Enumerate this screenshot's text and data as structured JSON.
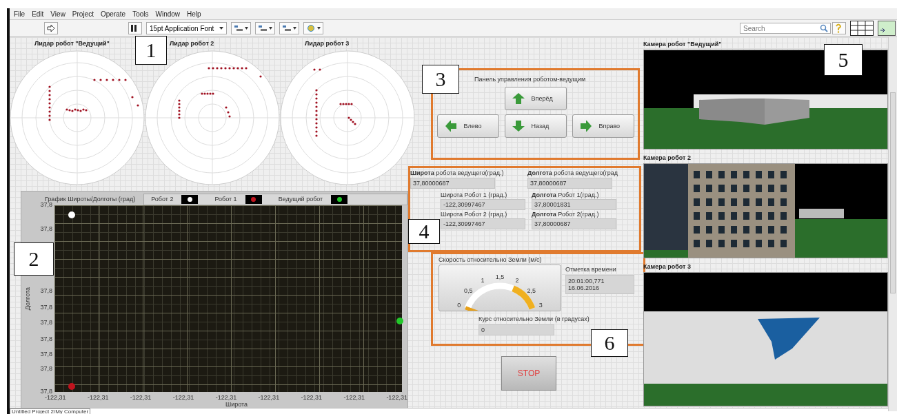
{
  "menu": [
    "File",
    "Edit",
    "View",
    "Project",
    "Operate",
    "Tools",
    "Window",
    "Help"
  ],
  "toolbar": {
    "font": "15pt Application Font",
    "search_placeholder": "Search"
  },
  "lidars": [
    {
      "title": "Лидар робот \"Ведущий\""
    },
    {
      "title": "Лидар робот 2"
    },
    {
      "title": "Лидар робот 3"
    }
  ],
  "chart": {
    "title": "График Широты/Долготы (град)",
    "y_label": "Долгота",
    "x_label": "Широта",
    "legend": [
      {
        "name": "Робот 2",
        "color": "#ffffff"
      },
      {
        "name": "Робот 1",
        "color": "#c0141e"
      },
      {
        "name": "Ведущий робот",
        "color": "#22c72a"
      }
    ],
    "y_tick_labels": [
      "37,8",
      "37,8",
      "37,8",
      "37,8",
      "37,8",
      "37,8",
      "37,8",
      "37,8",
      "37,8"
    ],
    "x_tick_labels": [
      "-122,31",
      "-122,31",
      "-122,31",
      "-122,31",
      "-122,31",
      "-122,31",
      "-122,31",
      "-122,31",
      "-122,31"
    ]
  },
  "control_panel": {
    "title": "Панель управления роботом-ведущим",
    "buttons": [
      {
        "label": "Вперёд",
        "kind": "up"
      },
      {
        "label": "Влево",
        "kind": "left"
      },
      {
        "label": "Назад",
        "kind": "down"
      },
      {
        "label": "Вправо",
        "kind": "right"
      }
    ]
  },
  "coordinates": {
    "leader": [
      {
        "label": "**Широта** робота ведущего(град.)",
        "value": "37,80000687"
      },
      {
        "label": "**Долгота** робота ведущего(град",
        "value": "37,80000687"
      }
    ],
    "robots": [
      {
        "label": "Широта Робот 1 (град.)",
        "value": "-122,30997467"
      },
      {
        "label": "**Долгота** Робот 1(град.)",
        "value": "37,80001831"
      },
      {
        "label": "Широта Робот 2 (град.)",
        "value": "-122,30997467"
      },
      {
        "label": "**Долгота** Робот 2(град.)",
        "value": "37,80000687"
      }
    ]
  },
  "speed": {
    "title": "Скорость относительно Земли (м/с)",
    "scale": [
      "0",
      "0,5",
      "1",
      "1,5",
      "2",
      "2,5",
      "3"
    ],
    "timestamp_label": "Отметка времени",
    "timestamp_lines": [
      "20:01:00,771",
      "16.06.2016"
    ],
    "heading_label": "Курс относительно Земли (в градусах)",
    "heading": "0"
  },
  "stop_button": "STOP",
  "cameras": [
    {
      "title": "Камера робот \"Ведущий\"",
      "kind": "arena"
    },
    {
      "title": "Камера робот 2",
      "kind": "buildings"
    },
    {
      "title": "Камера робот 3",
      "kind": "banner"
    }
  ],
  "callouts": [
    "1",
    "2",
    "3",
    "4",
    "5",
    "6"
  ],
  "status_bar": {
    "path": "Untitled Project 2/My Computer"
  }
}
